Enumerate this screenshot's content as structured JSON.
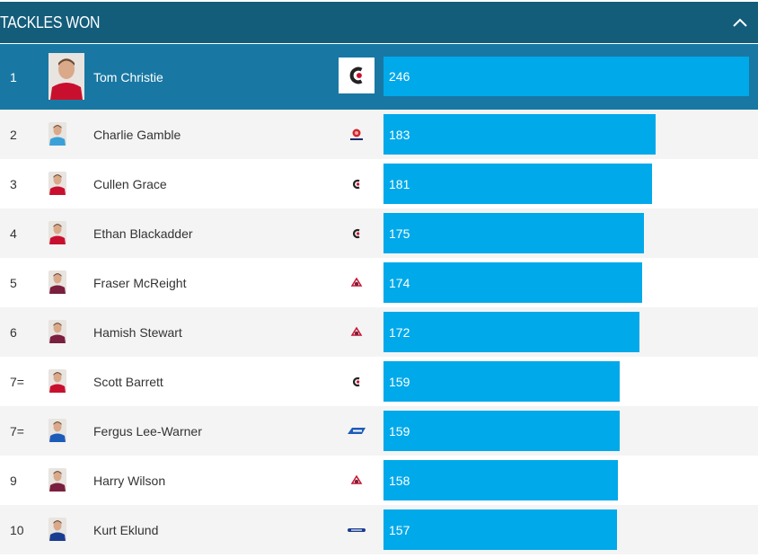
{
  "header": {
    "title": "TACKLES WON",
    "collapse_icon": "chevron-up-icon"
  },
  "max_value": 246,
  "players": [
    {
      "rank": "1",
      "name": "Tom Christie",
      "value": 246,
      "team_logo": "crusaders-logo"
    },
    {
      "rank": "2",
      "name": "Charlie Gamble",
      "value": 183,
      "team_logo": "waratahs-logo"
    },
    {
      "rank": "3",
      "name": "Cullen Grace",
      "value": 181,
      "team_logo": "crusaders-logo"
    },
    {
      "rank": "4",
      "name": "Ethan Blackadder",
      "value": 175,
      "team_logo": "crusaders-logo"
    },
    {
      "rank": "5",
      "name": "Fraser McReight",
      "value": 174,
      "team_logo": "reds-logo"
    },
    {
      "rank": "6",
      "name": "Hamish Stewart",
      "value": 172,
      "team_logo": "reds-logo"
    },
    {
      "rank": "7=",
      "name": "Scott Barrett",
      "value": 159,
      "team_logo": "crusaders-logo"
    },
    {
      "rank": "7=",
      "name": "Fergus Lee-Warner",
      "value": 159,
      "team_logo": "force-logo"
    },
    {
      "rank": "9",
      "name": "Harry Wilson",
      "value": 158,
      "team_logo": "reds-logo"
    },
    {
      "rank": "10",
      "name": "Kurt Eklund",
      "value": 157,
      "team_logo": "blues-logo"
    }
  ],
  "colors": {
    "header_bg": "#135d7b",
    "leader_row_bg": "#1878a3",
    "bar": "#00a9ea",
    "crusaders_red": "#c8102e",
    "reds_maroon": "#7a1f3d",
    "blues_navy": "#1a3d8f",
    "force_blue": "#1d5bb8"
  }
}
